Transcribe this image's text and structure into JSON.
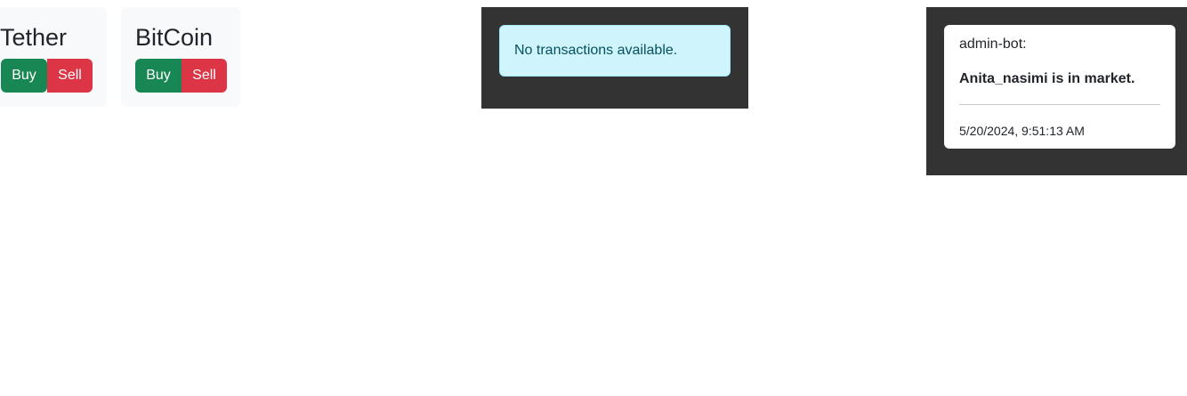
{
  "coins": [
    {
      "name": "Tether",
      "buy_label": "Buy",
      "sell_label": "Sell"
    },
    {
      "name": "BitCoin",
      "buy_label": "Buy",
      "sell_label": "Sell"
    }
  ],
  "transactions": {
    "empty_message": "No transactions available."
  },
  "chat": {
    "messages": [
      {
        "sender": "admin-bot:",
        "text": "Anita_nasimi is in market.",
        "timestamp": "5/20/2024, 9:51:13 AM"
      }
    ]
  },
  "colors": {
    "buy": "#198754",
    "sell": "#dc3545",
    "panel_bg": "#333333",
    "info_alert_bg": "#cff4fc",
    "info_alert_text": "#055160",
    "card_bg": "#f8f9fa"
  }
}
